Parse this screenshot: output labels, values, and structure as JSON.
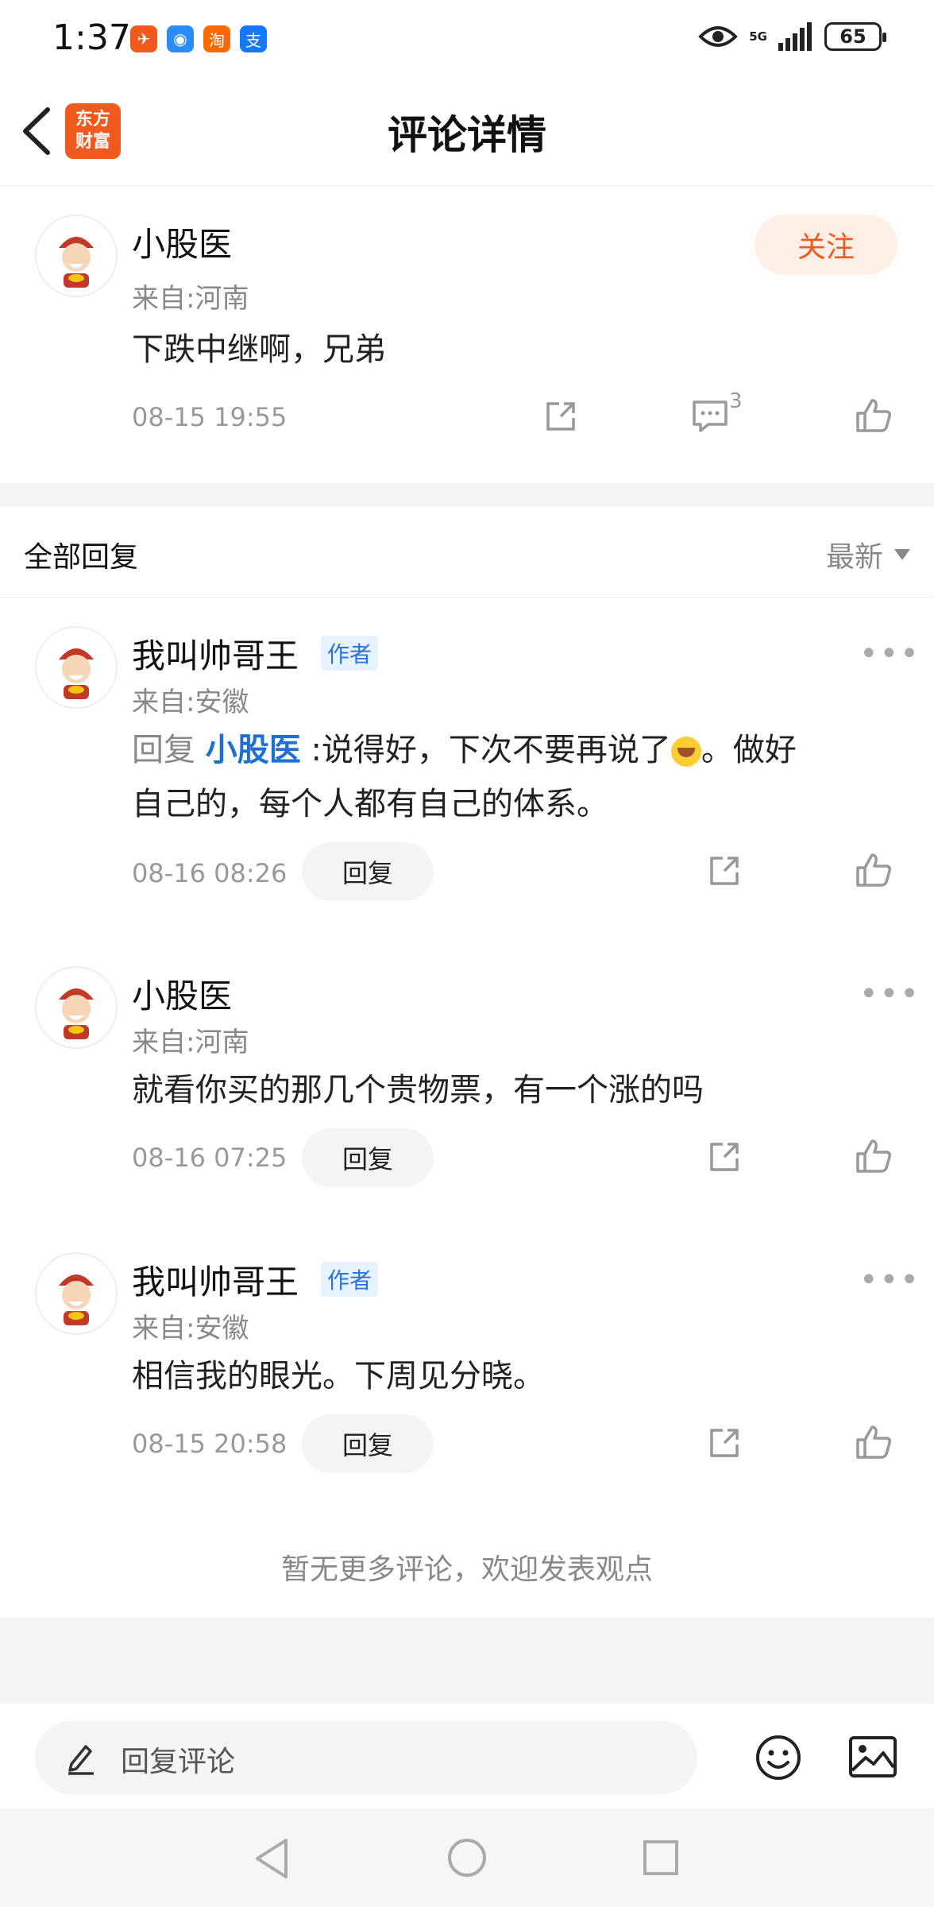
{
  "status_bar": {
    "time": "1:37",
    "apps": [
      {
        "name": "app-1",
        "glyph": "✈",
        "color": "#f05a1e"
      },
      {
        "name": "app-2",
        "glyph": "◉",
        "color": "#2b8cf5"
      },
      {
        "name": "taobao",
        "glyph": "淘",
        "color": "#ff6a00"
      },
      {
        "name": "alipay",
        "glyph": "支",
        "color": "#1677ff"
      }
    ],
    "network": "5G",
    "battery": "65"
  },
  "header": {
    "title": "评论详情",
    "logo_line1": "东方",
    "logo_line2": "财富"
  },
  "main_comment": {
    "author": "小股医",
    "from": "来自:河南",
    "text": "下跌中继啊，兄弟",
    "time": "08-15 19:55",
    "reply_count": "3",
    "follow_label": "关注"
  },
  "replies_section": {
    "title": "全部回复",
    "sort_label": "最新"
  },
  "replies": [
    {
      "author": "我叫帅哥王",
      "badge": "作者",
      "from": "来自:安徽",
      "reply_prefix": "回复",
      "reply_to": "小股医",
      "text_part1": ":说得好，下次不要再说了",
      "text_part2": "。做好",
      "text_line2": "自己的，每个人都有自己的体系。",
      "time": "08-16 08:26",
      "reply_label": "回复"
    },
    {
      "author": "小股医",
      "from": "来自:河南",
      "text": "就看你买的那几个贵物票，有一个涨的吗",
      "time": "08-16 07:25",
      "reply_label": "回复"
    },
    {
      "author": "我叫帅哥王",
      "badge": "作者",
      "from": "来自:安徽",
      "text": "相信我的眼光。下周见分晓。",
      "time": "08-15 20:58",
      "reply_label": "回复"
    }
  ],
  "footer": {
    "no_more_text": "暂无更多评论，欢迎发表观点",
    "input_placeholder": "回复评论"
  }
}
